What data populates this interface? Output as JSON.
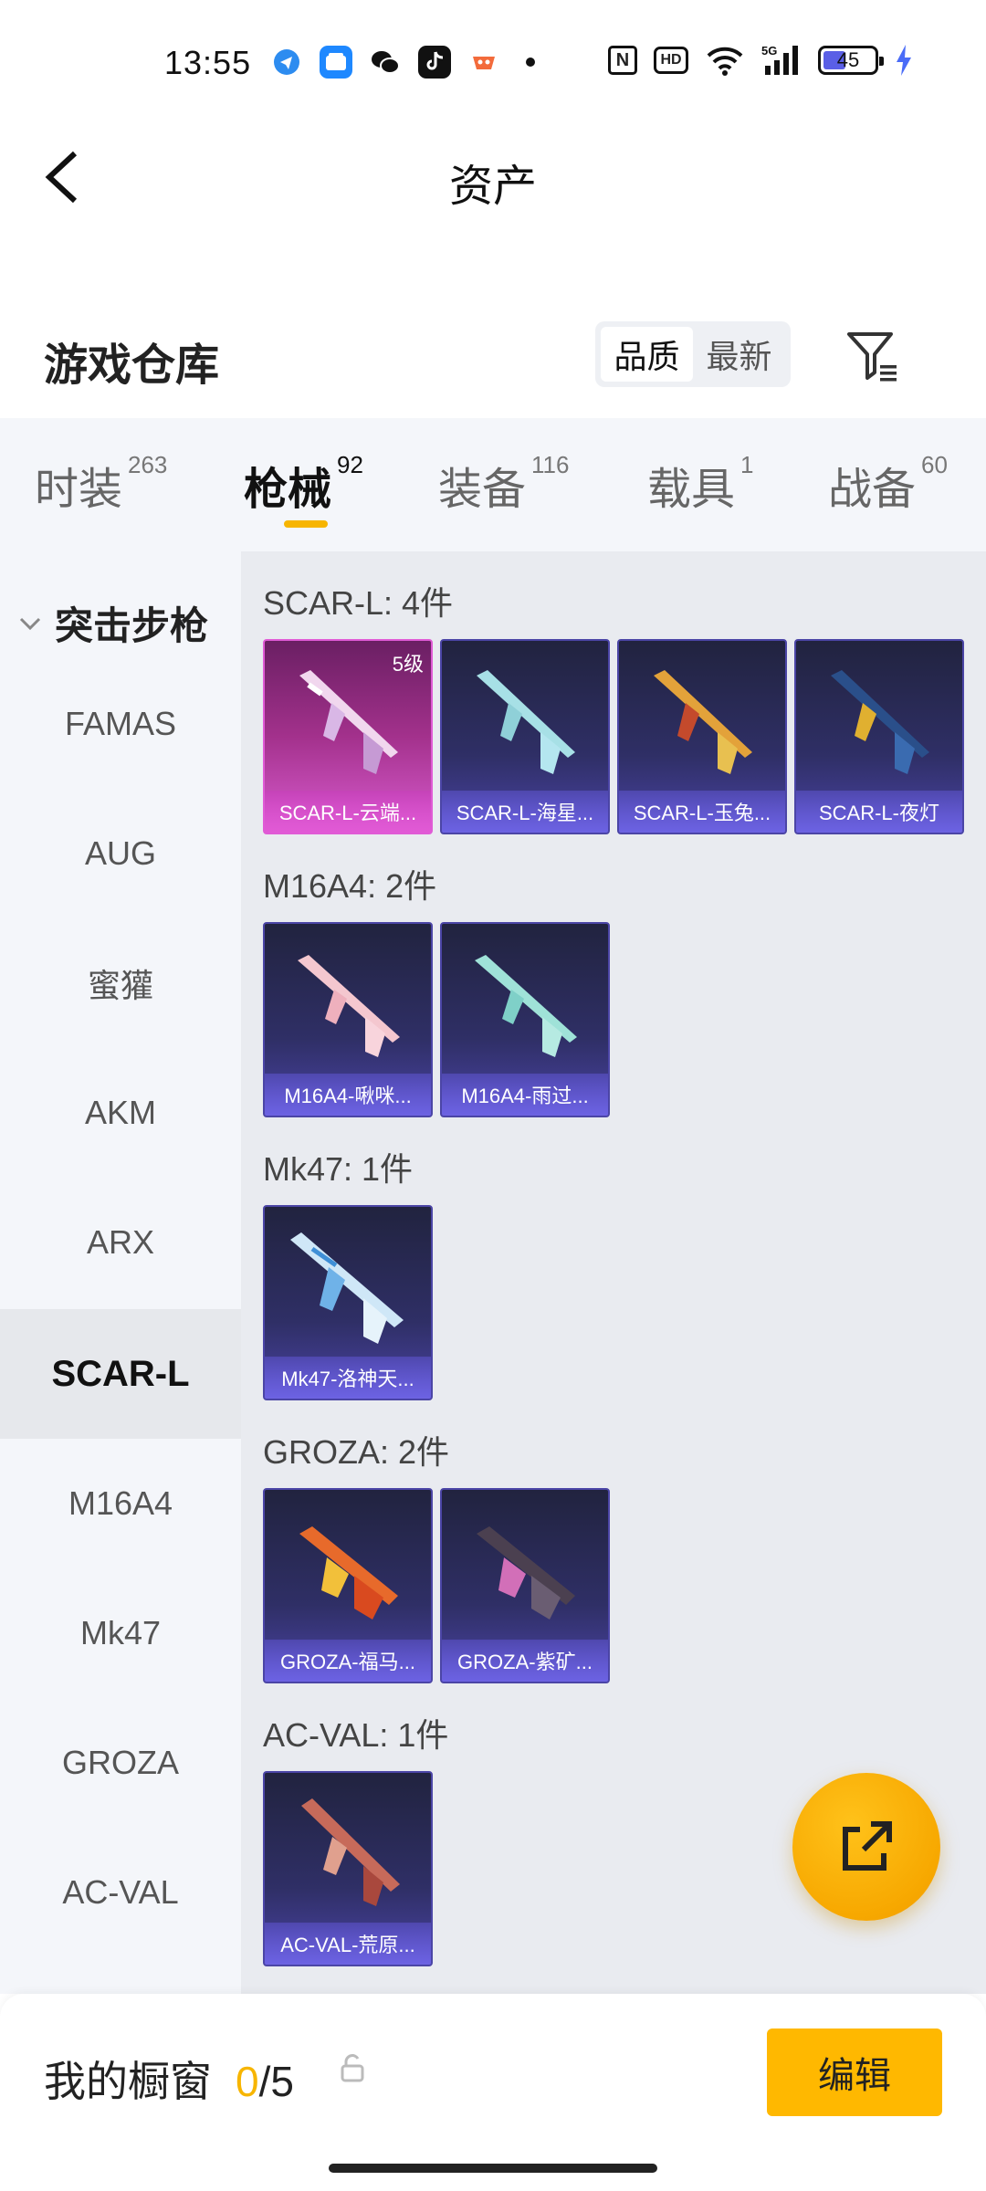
{
  "status_bar": {
    "time": "13:55",
    "battery": "45",
    "signal": "5G",
    "apps": [
      "telegram-icon",
      "blue-app-icon",
      "wechat-icon",
      "tiktok-icon",
      "game-icon"
    ]
  },
  "header": {
    "title": "资产"
  },
  "warehouse": {
    "title": "游戏仓库",
    "sort_options": [
      "品质",
      "最新"
    ],
    "sort_active": "品质"
  },
  "tabs": [
    {
      "label": "时装",
      "count": "263"
    },
    {
      "label": "枪械",
      "count": "92"
    },
    {
      "label": "装备",
      "count": "116"
    },
    {
      "label": "载具",
      "count": "1"
    },
    {
      "label": "战备",
      "count": "60"
    }
  ],
  "sidebar": {
    "category": "突击步枪",
    "items": [
      "FAMAS",
      "AUG",
      "蜜獾",
      "AKM",
      "ARX",
      "SCAR-L",
      "M16A4",
      "Mk47",
      "GROZA",
      "AC-VAL"
    ],
    "active": "SCAR-L"
  },
  "groups": [
    {
      "title": "SCAR-L: 4件",
      "items": [
        {
          "label": "SCAR-L-云端...",
          "level": "5级",
          "rarity": "legendary"
        },
        {
          "label": "SCAR-L-海星...",
          "rarity": "epic"
        },
        {
          "label": "SCAR-L-玉兔...",
          "rarity": "epic"
        },
        {
          "label": "SCAR-L-夜灯",
          "rarity": "epic"
        }
      ]
    },
    {
      "title": "M16A4: 2件",
      "items": [
        {
          "label": "M16A4-啾咪...",
          "rarity": "epic"
        },
        {
          "label": "M16A4-雨过...",
          "rarity": "epic"
        }
      ]
    },
    {
      "title": "Mk47: 1件",
      "items": [
        {
          "label": "Mk47-洛神天...",
          "rarity": "epic"
        }
      ]
    },
    {
      "title": "GROZA: 2件",
      "items": [
        {
          "label": "GROZA-福马...",
          "rarity": "epic"
        },
        {
          "label": "GROZA-紫矿...",
          "rarity": "epic"
        }
      ]
    },
    {
      "title": "AC-VAL: 1件",
      "items": [
        {
          "label": "AC-VAL-荒原...",
          "rarity": "epic"
        }
      ]
    }
  ],
  "bottom": {
    "showcase_label": "我的橱窗",
    "showcase_current": "0",
    "showcase_total": "/5",
    "edit_label": "编辑"
  },
  "colors": {
    "accent": "#f7b500",
    "tab_bg": "#f4f6fa",
    "content_bg": "#e9ebf0",
    "card_epic": "#4b45a6",
    "card_legendary": "#e05bd6"
  }
}
